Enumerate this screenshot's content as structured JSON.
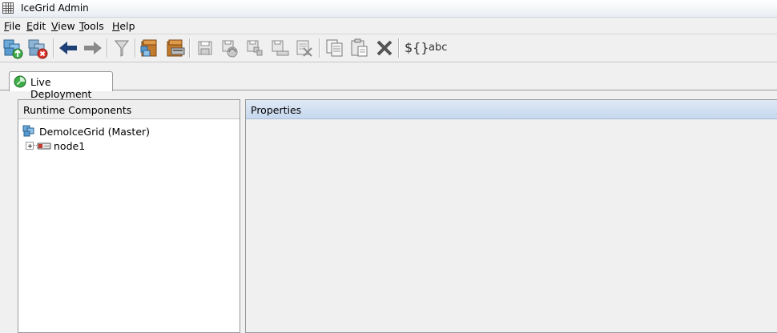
{
  "window": {
    "title": "IceGrid Admin",
    "icon": "grid-app-icon"
  },
  "menu": [
    {
      "mnemonic": "F",
      "rest": "ile"
    },
    {
      "mnemonic": "E",
      "rest": "dit"
    },
    {
      "mnemonic": "V",
      "rest": "iew"
    },
    {
      "mnemonic": "T",
      "rest": "ools"
    },
    {
      "mnemonic": "H",
      "rest": "elp"
    }
  ],
  "toolbar": {
    "icons": [
      "login-icon",
      "logout-icon",
      "back-arrow-icon",
      "forward-arrow-icon",
      "filter-icon",
      "open-application-icon",
      "open-application-registry-icon",
      "save-icon",
      "save-to-registry-icon",
      "save-to-registry-without-restart-icon",
      "save-to-file-icon",
      "discard-updates-icon",
      "copy-icon",
      "paste-icon",
      "delete-icon"
    ],
    "substitute_variables": "${}",
    "show_variables": "abc"
  },
  "tab": {
    "label": "Live Deployment"
  },
  "runtime_components": {
    "header": "Runtime Components",
    "root": "DemoIceGrid (Master)",
    "nodes": [
      "node1"
    ]
  },
  "properties": {
    "header": "Properties"
  }
}
